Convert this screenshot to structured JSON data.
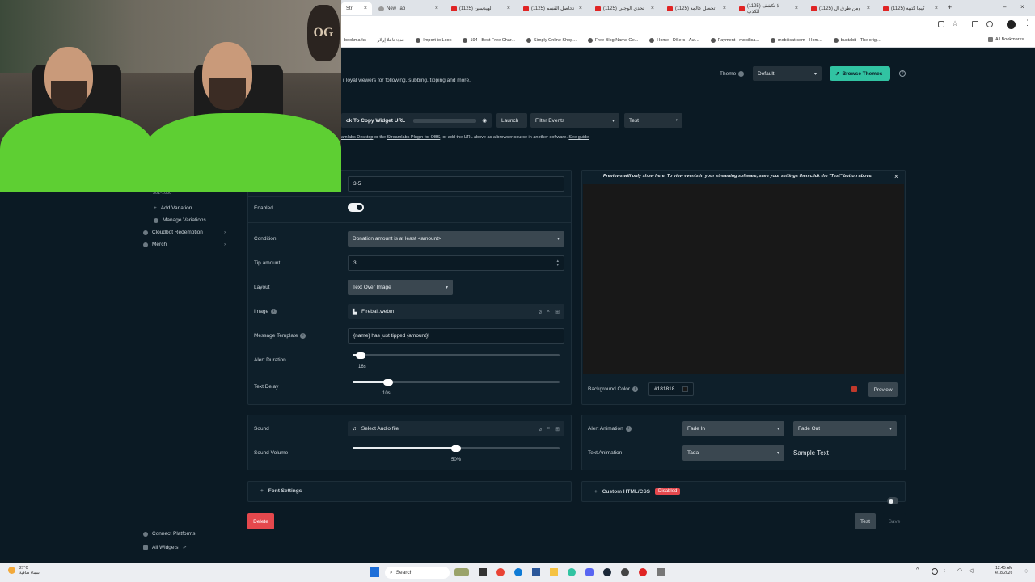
{
  "browser": {
    "tabs": [
      {
        "label": "Str"
      },
      {
        "label": "New Tab"
      },
      {
        "label": "(1125) الهيدسين"
      },
      {
        "label": "(1125) تحاصل القسم"
      },
      {
        "label": "(1125) تحدي الوجبي"
      },
      {
        "label": "(1125) تحضل عالمه"
      },
      {
        "label": "(1125) لا تكشف الكذب"
      },
      {
        "label": "(1125) ومن طرق ال"
      },
      {
        "label": "(1125) كيما كتبيه"
      }
    ],
    "bookmarks": [
      "bookmarks",
      "عدة: تاعلا إرلار",
      "Import to Loox",
      "194+ Best Free Char...",
      "Simply Online Shop...",
      "Free Blog Name Ge...",
      "Home - DSers - Aut...",
      "Payment - mobilisa...",
      "mobilisat.com - Hom...",
      "bustabit - The origi..."
    ],
    "all_bookmarks": "All Bookmarks"
  },
  "webcam": {
    "logo": "OG"
  },
  "header": {
    "intro": "r loyal viewers for following, subbing, tipping and more.",
    "theme_label": "Theme",
    "theme_value": "Default",
    "browse_themes": "Browse Themes",
    "widget_url_label": "ck To Copy Widget URL",
    "launch": "Launch",
    "filter_events": "Filter Events",
    "test": "Test",
    "hint_start": "amlabs Desktop",
    "hint_or": " or the ",
    "hint_link": "Streamlabs Plugin for OBS",
    "hint_rest": ", or add the URL above as a browser source in another software.",
    "hint_guide": "See guide"
  },
  "sidebar": {
    "partial": "301-1000",
    "items": [
      {
        "label": "Add Variation"
      },
      {
        "label": "Manage Variations"
      },
      {
        "label": "Cloudbot Redemption"
      },
      {
        "label": "Merch"
      }
    ],
    "bottom": [
      {
        "label": "Connect Platforms"
      },
      {
        "label": "All Widgets"
      }
    ]
  },
  "form": {
    "name_value": "3-5",
    "enabled_label": "Enabled",
    "condition_label": "Condition",
    "condition_value": "Donation amount is at least <amount>",
    "tip_label": "Tip amount",
    "tip_value": "3",
    "layout_label": "Layout",
    "layout_value": "Text Over Image",
    "image_label": "Image",
    "image_value": "Fireball.webm",
    "template_label": "Message Template",
    "template_value": "{name} has just tipped {amount}!",
    "duration_label": "Alert Duration",
    "duration_value": "16s",
    "duration_pct": 0.04,
    "delay_label": "Text Delay",
    "delay_value": "10s",
    "delay_pct": 0.17
  },
  "sound": {
    "sound_label": "Sound",
    "sound_value": "Select Audio file",
    "volume_label": "Sound Volume",
    "volume_value": "50%",
    "volume_pct": 0.5
  },
  "preview": {
    "notice": "Previews will only show here. To view events in your streaming software, save your settings then click the \"Test\" button above.",
    "bg_label": "Background Color",
    "bg_value": "#181818",
    "preview_btn": "Preview"
  },
  "animation": {
    "alert_label": "Alert Animation",
    "alert_in": "Fade In",
    "alert_out": "Fade Out",
    "text_label": "Text Animation",
    "text_value": "Tada",
    "sample": "Sample Text"
  },
  "extra": {
    "font_settings": "Font Settings",
    "custom_css": "Custom HTML/CSS",
    "disabled_badge": "Disabled",
    "delete": "Delete",
    "test": "Test",
    "save": "Save"
  },
  "taskbar": {
    "weather_temp": "27°C",
    "weather_desc": "سماء صافية",
    "search": "Search",
    "time": "12:45 AM",
    "date": "4/18/2026"
  },
  "colors": {
    "accent": "#31c3a2",
    "danger": "#e5484d",
    "bg": "#0b1a24",
    "panel": "#0e1f2a"
  }
}
